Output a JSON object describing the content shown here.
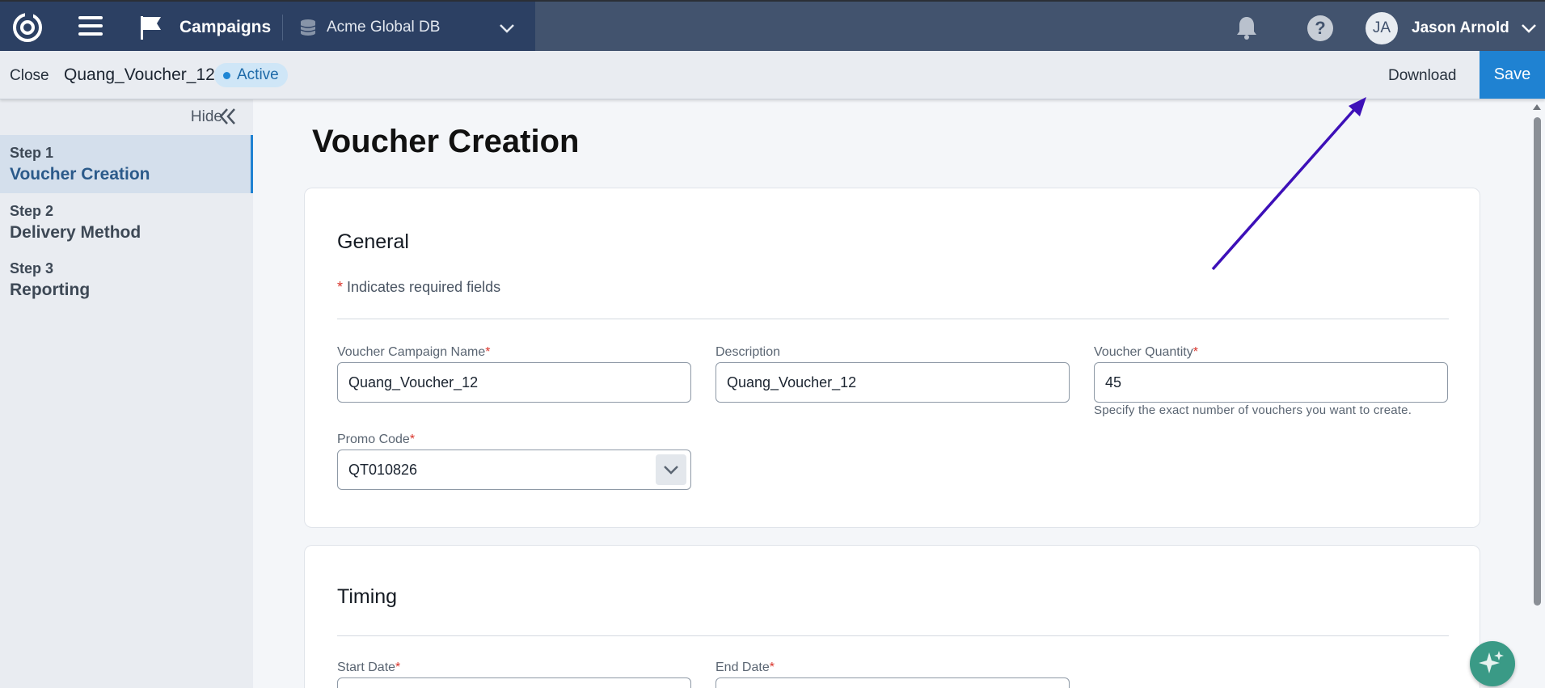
{
  "topbar": {
    "app_title": "Campaigns",
    "database": "Acme Global DB",
    "user_initials": "JA",
    "user_name": "Jason Arnold",
    "help_symbol": "?"
  },
  "subbar": {
    "close_label": "Close",
    "campaign_name": "Quang_Voucher_12",
    "status": "Active",
    "download_label": "Download",
    "save_label": "Save"
  },
  "sidebar": {
    "hide_label": "Hide",
    "steps": [
      {
        "number": "Step 1",
        "title": "Voucher Creation",
        "active": true
      },
      {
        "number": "Step 2",
        "title": "Delivery Method",
        "active": false
      },
      {
        "number": "Step 3",
        "title": "Reporting",
        "active": false
      }
    ]
  },
  "main": {
    "page_title": "Voucher Creation",
    "general": {
      "title": "General",
      "required_star": "*",
      "required_note": " Indicates required fields",
      "fields": {
        "campaign_name_label": "Voucher Campaign Name",
        "campaign_name_value": "Quang_Voucher_12",
        "description_label": "Description",
        "description_value": "Quang_Voucher_12",
        "quantity_label": "Voucher Quantity",
        "quantity_value": "45",
        "quantity_help": "Specify the exact number of vouchers you want to create.",
        "promo_label": "Promo Code",
        "promo_value": "QT010826"
      }
    },
    "timing": {
      "title": "Timing",
      "start_label": "Start Date",
      "end_label": "End Date"
    }
  },
  "colors": {
    "topbar": "#42536e",
    "topbar_left": "#2c4063",
    "accent": "#1f82d2",
    "annotation_arrow": "#3d10b8",
    "required": "#d9342b"
  },
  "icons": [
    "logo-icon",
    "menu-icon",
    "flag-icon",
    "database-icon",
    "chevron-down-icon",
    "bell-icon",
    "help-icon",
    "double-chevron-left-icon",
    "sparkle-icon"
  ]
}
